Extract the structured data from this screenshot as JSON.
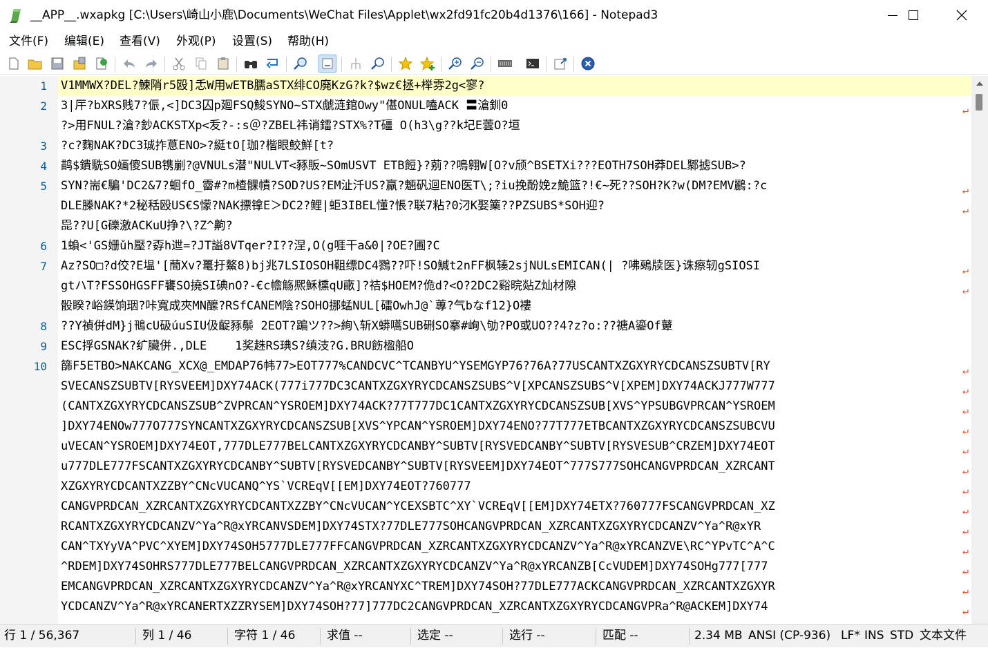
{
  "window": {
    "title": "__APP__.wxapkg [C:\\Users\\崎山小鹿\\Documents\\WeChat Files\\Applet\\wx2fd91fc20b4d1376\\166] - Notepad3",
    "minimize_icon": "minimize-icon",
    "maximize_icon": "maximize-icon",
    "close_icon": "close-icon"
  },
  "menu": [
    {
      "label": "文件(F)"
    },
    {
      "label": "编辑(E)"
    },
    {
      "label": "查看(V)"
    },
    {
      "label": "外观(P)"
    },
    {
      "label": "设置(S)"
    },
    {
      "label": "帮助(H)"
    }
  ],
  "toolbar": [
    "new-file-icon",
    "open-folder-icon",
    "save-icon",
    "save-as-icon",
    "browse-icon",
    "undo-icon",
    "redo-icon",
    "cut-icon",
    "copy-icon",
    "paste-icon",
    "find-icon",
    "replace-icon",
    "find-next-icon",
    "word-wrap-icon",
    "column-mode-icon",
    "zoom-find-icon",
    "bookmark-icon",
    "add-bookmark-icon",
    "zoom-in-icon",
    "zoom-out-icon",
    "encoding-icon",
    "console-icon",
    "pin-icon",
    "close-file-icon"
  ],
  "editor": {
    "lines": [
      {
        "num": "1",
        "text": "V1MMWX?DEL?鰊陗r5殴]忎W用wETB臑aSTX绯CO廃KzG?k?$wz€拯+榉雰2g<寥?",
        "current": true,
        "wrap": false
      },
      {
        "num": "2",
        "text": "3|厈?bXRS贱7?侲,<]DC3囚p廻FSQ鮻SYNO~STX虤涟錧Owy\"偡ONUL嗑ACK 〓滄釧0",
        "wrap": true
      },
      {
        "num": "",
        "text": "?>用FNUL?滄?鈔ACKSTXp<叐?-:s＠?ZBEL祎诮鐳?STX%?T礓 O(h3\\g??k圮E蕓O?垣",
        "wrap": false
      },
      {
        "num": "3",
        "text": "?c?麴NAK?DC3珹拃蒠ENO>?綎tO[珈?楷眼鮫鮮[t?",
        "wrap": false
      },
      {
        "num": "4",
        "text": "鹋$鐀駪SO婳傻SUB镌剻?@VNULs潜\"NULVT<豩販~SOmUSVT ETB餖}?莂??鳴翱W[O?v颀^BSETXi???EOTH7SOH莽DEL鄹摅SUB>?",
        "wrap": false
      },
      {
        "num": "5",
        "text": "SYN?耑€騙'DC2&7?蛔fO_霤#?m楂髁幘?SOD?US?EM沚汘US?羸?魎矾迴ENO医T\\;?iu挽酚娩z鮠篮?!€~死??SOH?K?w(DM?EMV鸝:?c",
        "wrap": true
      },
      {
        "num": "",
        "text": "DLE榺NAK?*2秘秳殴US€S懞?NAK摽镎E＞DC2?鲤|蚷3IBEL懂?悵?联7粘?0汈K娶篥??PZSUBS*SOH迎?",
        "wrap": true
      },
      {
        "num": "",
        "text": "巼??U[G礫激ACKuU挣?\\?Z^齁?",
        "wrap": false
      },
      {
        "num": "6",
        "text": "1蝜<'GS姗ǔh壓?孬h迣=?JT謚8VTqer?I??涅,O(g啀干a&0|?OE?圃?C",
        "wrap": false
      },
      {
        "num": "7",
        "text": "Az?SO□?d佼?E塭'[蕳Xv?鼍扜鰲8)bj兆7LSIOSOH靻缥DC4鷚??吓!SO鰔t2nFF枫辏2sjNULsEMICAN(| ?咈鵐牍医}诛瘵轫gSIOSI",
        "wrap": true
      },
      {
        "num": "",
        "text": "gtハT?FSSOHGSFF饔SO撓SI碘nO?-€c幨觞熈穌櫄qU畞]?祮$HOEM?佹d?<O?2DC2谿晥煔Z灿材隙",
        "wrap": true
      },
      {
        "num": "",
        "text": "骰睽?峪鍈饷珚?咔寬成夾MN醿?RSfCANEM陰?SOHO挪蜢NUL[礌OwhJ@`蓴?气bなf12}O褸",
        "wrap": false
      },
      {
        "num": "8",
        "text": "??Y禎併dM}j鳵cU砐úuSIU伋齪豩鬃 2EOT?蹁ツ??>絢\\斩X蟒嚆SUB硎SO搴#峋\\劬?PO或UO??4?z?o:??禟A鎏Of鼙",
        "wrap": false
      },
      {
        "num": "9",
        "text": "ESC捊GSNAK?纩臟併.,DLE    1奖趎RS琠S?缜汥?G.BRU飭楹船O",
        "wrap": false
      },
      {
        "num": "10",
        "text": "篩F5ETBO>NAKCANG_XCX@_EMDAP76帏77>EOT777%CANDCVC^TCANBYU^YSEMGYP76?76A?77USCANTXZGXYRYCDCANSZSUBTV[RY",
        "wrap": true
      },
      {
        "num": "",
        "text": "SVECANSZSUBTV[RYSVEEM]DXY74ACK(777i777DC3CANTXZGXYRYCDCANSZSUBS^V[XPCANSZSUBS^V[XPEM]DXY74ACKJ777W777",
        "wrap": true
      },
      {
        "num": "",
        "text": "(CANTXZGXYRYCDCANSZSUB^ZVPRCAN^YSROEM]DXY74ACK?77T777DC1CANTXZGXYRYCDCANSZSUB[XVS^YPSUBGVPRCAN^YSROEM",
        "wrap": true
      },
      {
        "num": "",
        "text": "]DXY74ENOw777O777SYNCANTXZGXYRYCDCANSZSUB[XVS^YPCAN^YSROEM]DXY74ENO?77T777ETBCANTXZGXYRYCDCANSZSUBCVU",
        "wrap": true
      },
      {
        "num": "",
        "text": "uVECAN^YSROEM]DXY74EOT,777DLE777BELCANTXZGXYRYCDCANBY^SUBTV[RYSVEDCANBY^SUBTV[RYSVESUB^CRZEM]DXY74EOT",
        "wrap": true
      },
      {
        "num": "",
        "text": "u777DLE777FSCANTXZGXYRYCDCANBY^SUBTV[RYSVEDCANBY^SUBTV[RYSVEEM]DXY74EOT^777S777SOHCANGVPRDCAN_XZRCANT",
        "wrap": true
      },
      {
        "num": "",
        "text": "XZGXYRYCDCANTXZZBY^CNcVUCANQ^YS`VCREqV[[EM]DXY74EOT?760777",
        "wrap": true
      },
      {
        "num": "",
        "text": "CANGVPRDCAN_XZRCANTXZGXYRYCDCANTXZZBY^CNcVUCAN^YCEXSBTC^XY`VCREqV[[EM]DXY74ETX?760777FSCANGVPRDCAN_XZ",
        "wrap": true
      },
      {
        "num": "",
        "text": "RCANTXZGXYRYCDCANZV^Ya^R@xYRCANVSDEM]DXY74STX?77DLE777SOHCANGVPRDCAN_XZRCANTXZGXYRYCDCANZV^Ya^R@xYR",
        "wrap": true
      },
      {
        "num": "",
        "text": "CAN^TXYyVA^PVC^XYEM]DXY74SOH5777DLE777FFCANGVPRDCAN_XZRCANTXZGXYRYCDCANZV^Ya^R@xYRCANZVE\\RC^YPvTC^A^C",
        "wrap": true
      },
      {
        "num": "",
        "text": "^RDEM]DXY74SOHRS777DLE777BELCANGVPRDCAN_XZRCANTXZGXYRYCDCANZV^Ya^R@xYRCANZB[CcVUDEM]DXY74SOHg777[777",
        "wrap": true
      },
      {
        "num": "",
        "text": "EMCANGVPRDCAN_XZRCANTXZGXYRYCDCANZV^Ya^R@xYRCANYXC^TREM]DXY74SOH?77DLE777ACKCANGVPRDCAN_XZRCANTXZGXYR",
        "wrap": true
      },
      {
        "num": "",
        "text": "YCDCANZV^Ya^R@xYRCANERTXZZRYSEM]DXY74SOH?77]777DC2CANGVPRDCAN_XZRCANTXZGXYRYCDCANGVPRa^R@ACKEM]DXY74",
        "wrap": true
      }
    ],
    "wrap_glyph": "↵"
  },
  "status": {
    "line": "行 1 / 56,367",
    "col": "列 1 / 46",
    "char": "字符 1 / 46",
    "eval": "求值 --",
    "sel": "选定 --",
    "selline": "选行 --",
    "match": "匹配 --",
    "size": "2.34 MB",
    "encoding": "ANSI (CP-936)",
    "eol": "LF*",
    "ins": "INS",
    "std": "STD",
    "filetype": "文本文件"
  }
}
